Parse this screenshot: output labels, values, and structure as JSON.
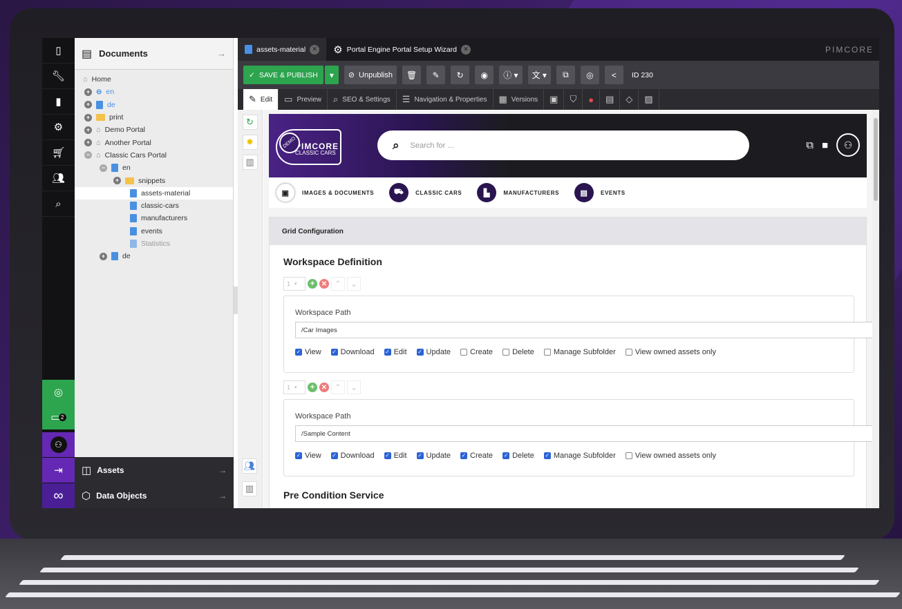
{
  "rail": {
    "icons": [
      "document-icon",
      "wrench-icon",
      "chart-icon",
      "gear-icon",
      "cart-icon",
      "users-icon",
      "search-icon"
    ],
    "chat_badge": "2"
  },
  "tree": {
    "title": "Documents",
    "nodes": [
      {
        "label": "Home"
      },
      {
        "label": "en"
      },
      {
        "label": "de"
      },
      {
        "label": "print"
      },
      {
        "label": "Demo Portal"
      },
      {
        "label": "Another Portal"
      },
      {
        "label": "Classic Cars Portal"
      },
      {
        "label": "en"
      },
      {
        "label": "snippets"
      },
      {
        "label": "assets-material"
      },
      {
        "label": "classic-cars"
      },
      {
        "label": "manufacturers"
      },
      {
        "label": "events"
      },
      {
        "label": "Statistics"
      },
      {
        "label": "de"
      }
    ],
    "assets_label": "Assets",
    "objects_label": "Data Objects"
  },
  "tabs": [
    {
      "label": "assets-material"
    },
    {
      "label": "Portal Engine Portal Setup Wizard"
    }
  ],
  "brand": "PIMCORE",
  "toolbar": {
    "save_publish": "SAVE & PUBLISH",
    "unpublish": "Unpublish",
    "id_label": "ID 230"
  },
  "subtabs": [
    {
      "label": "Edit"
    },
    {
      "label": "Preview"
    },
    {
      "label": "SEO & Settings"
    },
    {
      "label": "Navigation & Properties"
    },
    {
      "label": "Versions"
    }
  ],
  "hero": {
    "logo_demo": "DEMO",
    "logo_main": "PIMCORE",
    "logo_sub": "CLASSIC CARS",
    "search_placeholder": "Search for ..."
  },
  "nav": [
    {
      "label": "IMAGES & DOCUMENTS"
    },
    {
      "label": "CLASSIC CARS"
    },
    {
      "label": "MANUFACTURERS"
    },
    {
      "label": "EVENTS"
    }
  ],
  "grid": {
    "title": "Grid Configuration",
    "workspace_heading": "Workspace Definition",
    "index": "1",
    "path_label": "Workspace Path",
    "workspaces": [
      {
        "path": "/Car Images",
        "perms": [
          {
            "label": "View",
            "checked": true
          },
          {
            "label": "Download",
            "checked": true
          },
          {
            "label": "Edit",
            "checked": true
          },
          {
            "label": "Update",
            "checked": true
          },
          {
            "label": "Create",
            "checked": false
          },
          {
            "label": "Delete",
            "checked": false
          },
          {
            "label": "Manage Subfolder",
            "checked": false
          },
          {
            "label": "View owned assets only",
            "checked": false
          }
        ]
      },
      {
        "path": "/Sample Content",
        "perms": [
          {
            "label": "View",
            "checked": true
          },
          {
            "label": "Download",
            "checked": true
          },
          {
            "label": "Edit",
            "checked": true
          },
          {
            "label": "Update",
            "checked": true
          },
          {
            "label": "Create",
            "checked": true
          },
          {
            "label": "Delete",
            "checked": true
          },
          {
            "label": "Manage Subfolder",
            "checked": true
          },
          {
            "label": "View owned assets only",
            "checked": false
          }
        ]
      }
    ],
    "precondition_heading": "Pre Condition Service"
  }
}
